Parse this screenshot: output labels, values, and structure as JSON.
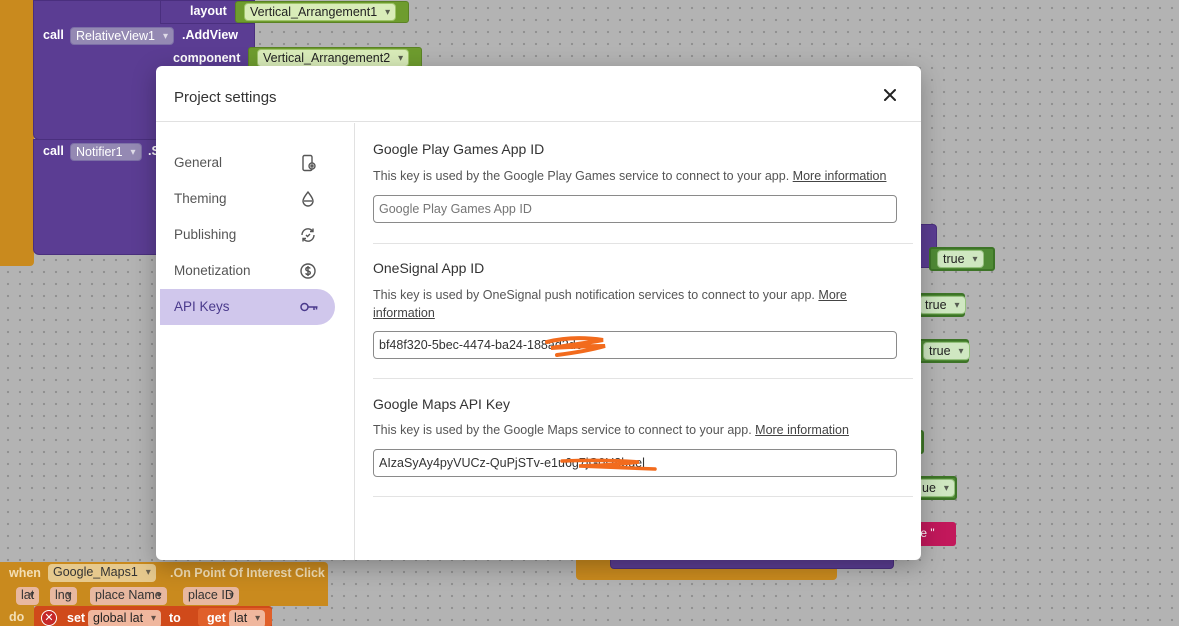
{
  "workspace": {
    "layout_label": "layout",
    "layout_component": "Vertical_Arrangement1",
    "call1_label": "call",
    "call1_component": "RelativeView1",
    "call1_method": ".AddView",
    "component_label": "component",
    "component_value": "Vertical_Arrangement2",
    "call2_label": "call",
    "call2_component": "Notifier1",
    "call2_method": ".S",
    "true_values": [
      "true",
      "true",
      "true",
      "ue"
    ],
    "pink_value": "te \"",
    "event_when": "when",
    "event_component": "Google_Maps1",
    "event_name": ".On Point Of Interest Click",
    "event_params": [
      "lat",
      "lng",
      "place Name",
      "place ID"
    ],
    "do_label": "do",
    "set_label": "set",
    "set_var": "global lat",
    "to_label": "to",
    "get_label": "get",
    "get_var": "lat"
  },
  "dialog": {
    "title": "Project settings",
    "close_icon": "close-icon",
    "sidebar": [
      {
        "label": "General",
        "icon": "device-settings-icon",
        "active": false
      },
      {
        "label": "Theming",
        "icon": "droplet-icon",
        "active": false
      },
      {
        "label": "Publishing",
        "icon": "publish-sync-icon",
        "active": false
      },
      {
        "label": "Monetization",
        "icon": "dollar-icon",
        "active": false
      },
      {
        "label": "API Keys",
        "icon": "key-icon",
        "active": true
      }
    ],
    "sections": [
      {
        "title": "Google Play Games App ID",
        "description": "This key is used by the Google Play Games service to connect to your app.",
        "more_link": "More information",
        "input_value": "",
        "placeholder": "Google Play Games App ID"
      },
      {
        "title": "OneSignal App ID",
        "description": "This key is used by OneSignal push notification services to connect to your app.",
        "more_link": "More information",
        "input_value": "bf48f320-5bec-4474-ba24-188ad2dc",
        "placeholder": ""
      },
      {
        "title": "Google Maps API Key",
        "description": "This key is used by the Google Maps service to connect to your app.",
        "more_link": "More information",
        "input_value": "AIzaSyAy4pyVUCz-QuPjSTv-e1u6g7jG0U8bqel",
        "placeholder": ""
      }
    ],
    "colors": {
      "active_bg": "#d0c7ec",
      "redaction": "#f26b1d",
      "block_purple": "#5b3d93",
      "block_orange": "#c98a1e"
    }
  }
}
